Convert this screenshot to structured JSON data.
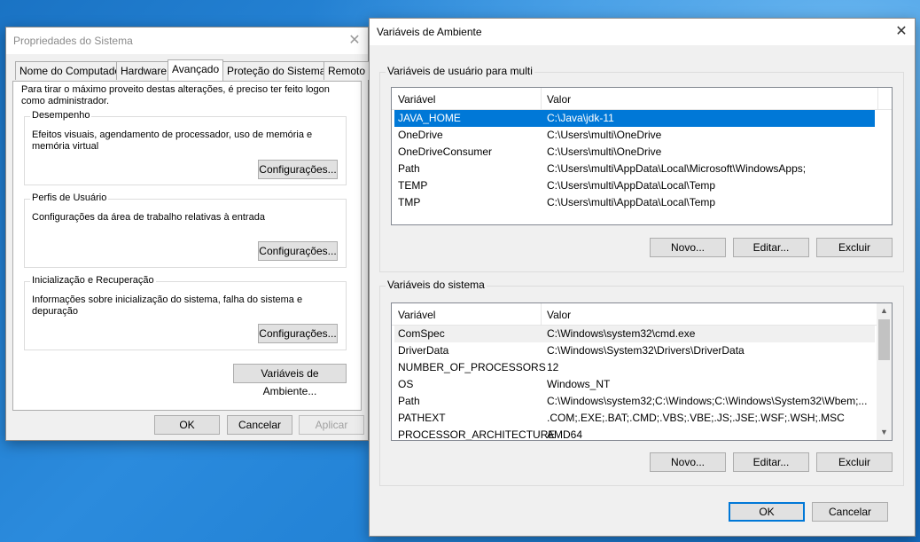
{
  "props": {
    "title": "Propriedades do Sistema",
    "tabs": [
      "Nome do Computador",
      "Hardware",
      "Avançado",
      "Proteção do Sistema",
      "Remoto"
    ],
    "intro": "Para tirar o máximo proveito destas alterações, é preciso ter feito logon como administrador.",
    "groups": [
      {
        "title": "Desempenho",
        "desc": "Efeitos visuais, agendamento de processador, uso de memória e memória virtual",
        "button": "Configurações..."
      },
      {
        "title": "Perfis de Usuário",
        "desc": "Configurações da área de trabalho relativas à entrada",
        "button": "Configurações..."
      },
      {
        "title": "Inicialização e Recuperação",
        "desc": "Informações sobre inicialização do sistema, falha do sistema e depuração",
        "button": "Configurações..."
      }
    ],
    "env_button": "Variáveis de Ambiente...",
    "ok": "OK",
    "cancel": "Cancelar",
    "apply": "Aplicar"
  },
  "env": {
    "title": "Variáveis de Ambiente",
    "user_section": "Variáveis de usuário para multi",
    "system_section": "Variáveis do sistema",
    "col_var": "Variável",
    "col_val": "Valor",
    "user_vars": [
      {
        "name": "JAVA_HOME",
        "value": "C:\\Java\\jdk-11"
      },
      {
        "name": "OneDrive",
        "value": "C:\\Users\\multi\\OneDrive"
      },
      {
        "name": "OneDriveConsumer",
        "value": "C:\\Users\\multi\\OneDrive"
      },
      {
        "name": "Path",
        "value": "C:\\Users\\multi\\AppData\\Local\\Microsoft\\WindowsApps;"
      },
      {
        "name": "TEMP",
        "value": "C:\\Users\\multi\\AppData\\Local\\Temp"
      },
      {
        "name": "TMP",
        "value": "C:\\Users\\multi\\AppData\\Local\\Temp"
      }
    ],
    "system_vars": [
      {
        "name": "ComSpec",
        "value": "C:\\Windows\\system32\\cmd.exe"
      },
      {
        "name": "DriverData",
        "value": "C:\\Windows\\System32\\Drivers\\DriverData"
      },
      {
        "name": "NUMBER_OF_PROCESSORS",
        "value": "12"
      },
      {
        "name": "OS",
        "value": "Windows_NT"
      },
      {
        "name": "Path",
        "value": "C:\\Windows\\system32;C:\\Windows;C:\\Windows\\System32\\Wbem;..."
      },
      {
        "name": "PATHEXT",
        "value": ".COM;.EXE;.BAT;.CMD;.VBS;.VBE;.JS;.JSE;.WSF;.WSH;.MSC"
      },
      {
        "name": "PROCESSOR_ARCHITECTURE",
        "value": "AMD64"
      }
    ],
    "new": "Novo...",
    "edit": "Editar...",
    "delete": "Excluir",
    "ok": "OK",
    "cancel": "Cancelar"
  }
}
